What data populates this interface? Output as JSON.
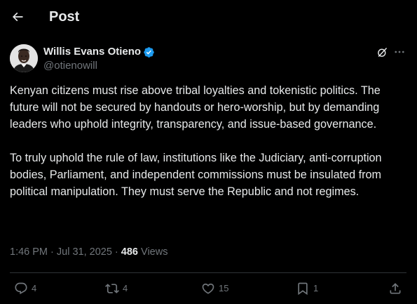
{
  "header": {
    "title": "Post",
    "back_icon": "arrow-left-icon"
  },
  "post": {
    "author": {
      "name": "Willis Evans Otieno",
      "handle": "@otienowill",
      "verified": true,
      "verified_color": "#1d9bf0"
    },
    "paragraphs": [
      "Kenyan citizens must rise above tribal loyalties and tokenistic politics. The future will not be secured by handouts or hero-worship, but by demanding leaders who uphold integrity, transparency, and issue-based governance.",
      "To truly uphold the rule of law, institutions like the Judiciary, anti-corruption bodies, Parliament, and independent commissions must be insulated from political manipulation. They must serve the Republic and not regimes."
    ],
    "time": "1:46 PM",
    "date": "Jul 31, 2025",
    "views_count": "486",
    "views_label": "Views"
  },
  "actions": {
    "replies": "4",
    "reposts": "4",
    "likes": "15",
    "bookmarks": "1"
  },
  "colors": {
    "background": "#000000",
    "text": "#e7e9ea",
    "muted": "#71767b",
    "divider": "#2f3336"
  }
}
